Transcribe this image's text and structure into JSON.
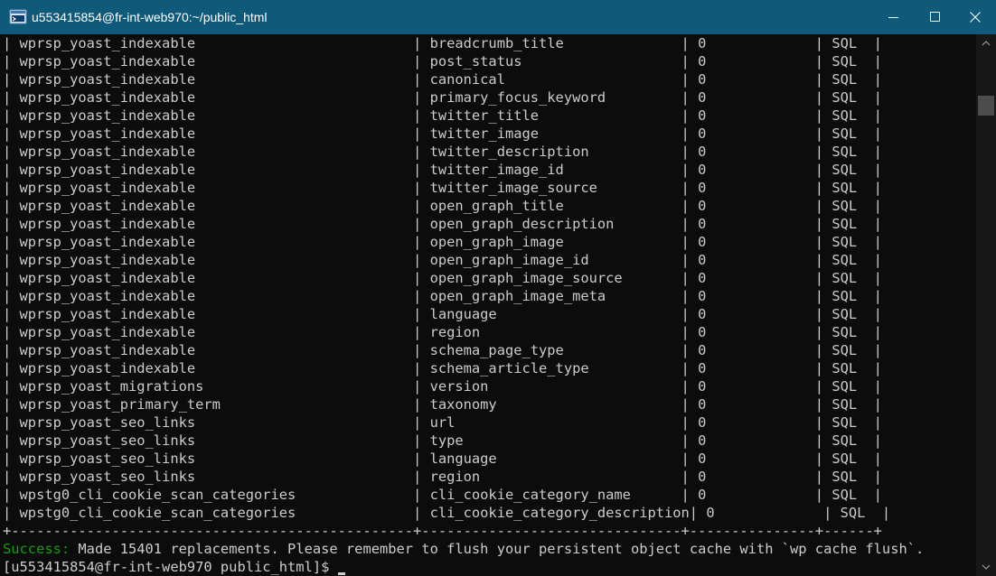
{
  "window": {
    "title": "u553415854@fr-int-web970:~/public_html",
    "icon": "terminal-icon",
    "buttons": [
      "minimize-icon",
      "maximize-icon",
      "close-icon"
    ]
  },
  "colors": {
    "titlebar": "#0f5a7a",
    "terminal_bg": "#0c0c0c",
    "terminal_fg": "#cccccc",
    "success": "#13a10e"
  },
  "table": {
    "rows": [
      [
        "wprsp_yoast_indexable",
        "breadcrumb_title",
        "0",
        "SQL"
      ],
      [
        "wprsp_yoast_indexable",
        "post_status",
        "0",
        "SQL"
      ],
      [
        "wprsp_yoast_indexable",
        "canonical",
        "0",
        "SQL"
      ],
      [
        "wprsp_yoast_indexable",
        "primary_focus_keyword",
        "0",
        "SQL"
      ],
      [
        "wprsp_yoast_indexable",
        "twitter_title",
        "0",
        "SQL"
      ],
      [
        "wprsp_yoast_indexable",
        "twitter_image",
        "0",
        "SQL"
      ],
      [
        "wprsp_yoast_indexable",
        "twitter_description",
        "0",
        "SQL"
      ],
      [
        "wprsp_yoast_indexable",
        "twitter_image_id",
        "0",
        "SQL"
      ],
      [
        "wprsp_yoast_indexable",
        "twitter_image_source",
        "0",
        "SQL"
      ],
      [
        "wprsp_yoast_indexable",
        "open_graph_title",
        "0",
        "SQL"
      ],
      [
        "wprsp_yoast_indexable",
        "open_graph_description",
        "0",
        "SQL"
      ],
      [
        "wprsp_yoast_indexable",
        "open_graph_image",
        "0",
        "SQL"
      ],
      [
        "wprsp_yoast_indexable",
        "open_graph_image_id",
        "0",
        "SQL"
      ],
      [
        "wprsp_yoast_indexable",
        "open_graph_image_source",
        "0",
        "SQL"
      ],
      [
        "wprsp_yoast_indexable",
        "open_graph_image_meta",
        "0",
        "SQL"
      ],
      [
        "wprsp_yoast_indexable",
        "language",
        "0",
        "SQL"
      ],
      [
        "wprsp_yoast_indexable",
        "region",
        "0",
        "SQL"
      ],
      [
        "wprsp_yoast_indexable",
        "schema_page_type",
        "0",
        "SQL"
      ],
      [
        "wprsp_yoast_indexable",
        "schema_article_type",
        "0",
        "SQL"
      ],
      [
        "wprsp_yoast_migrations",
        "version",
        "0",
        "SQL"
      ],
      [
        "wprsp_yoast_primary_term",
        "taxonomy",
        "0",
        "SQL"
      ],
      [
        "wprsp_yoast_seo_links",
        "url",
        "0",
        "SQL"
      ],
      [
        "wprsp_yoast_seo_links",
        "type",
        "0",
        "SQL"
      ],
      [
        "wprsp_yoast_seo_links",
        "language",
        "0",
        "SQL"
      ],
      [
        "wprsp_yoast_seo_links",
        "region",
        "0",
        "SQL"
      ],
      [
        "wpstg0_cli_cookie_scan_categories",
        "cli_cookie_category_name",
        "0",
        "SQL"
      ],
      [
        "wpstg0_cli_cookie_scan_categories",
        "cli_cookie_category_description",
        "0",
        "SQL"
      ]
    ],
    "separator": "+------------------------------------------------+-------------------------------+---------------+------+"
  },
  "status": {
    "label": "Success:",
    "message": " Made 15401 replacements. Please remember to flush your persistent object cache with `wp cache flush`."
  },
  "prompt": {
    "text": "[u553415854@fr-int-web970 public_html]$ "
  }
}
